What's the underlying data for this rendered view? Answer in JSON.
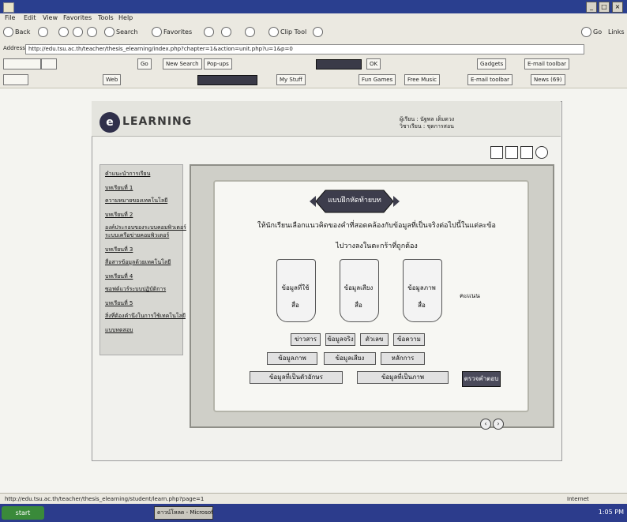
{
  "window": {
    "title": "",
    "min_glyph": "_",
    "max_glyph": "□",
    "close_glyph": "×"
  },
  "menu": [
    "File",
    "Edit",
    "View",
    "Favorites",
    "Tools",
    "Help"
  ],
  "toolbar": {
    "back": "Back",
    "search": "Search",
    "favorites": "Favorites",
    "clip_tool": "Clip Tool",
    "go": "Go",
    "links": "Links"
  },
  "address": {
    "label": "Address",
    "url": "http://edu.tsu.ac.th/teacher/thesis_elearning/index.php?chapter=1&action=unit.php?u=1&p=0"
  },
  "toolbar2": {
    "search_web": "Go",
    "news": "New Search",
    "popups": "Pop-ups",
    "ok": "OK",
    "gadgets": "Gadgets",
    "email": "E-mail toolbar"
  },
  "toolbar3": {
    "web": "Web",
    "my_stuff": "My Stuff",
    "fun_games": "Fun Games",
    "free_music": "Free Music",
    "email": "E-mail toolbar",
    "news": "News (69)"
  },
  "page": {
    "logo_mark": "e",
    "logo_text": "LEARNING",
    "user_line1": "ผู้เรียน : นัฐพล เต็มดวง",
    "user_line2": "วิชาเรียน : ชุดการสอน",
    "nav": [
      "คำแนะนำการเรียน",
      "บทเรียนที่ 1",
      "ความหมายของเทคโนโลยี",
      "บทเรียนที่ 2",
      "องค์ประกอบของระบบคอมพิวเตอร์",
      "ระบบเครือข่ายคอมพิวเตอร์",
      "บทเรียนที่ 3",
      "สื่อสารข้อมูลด้วยเทคโนโลยี",
      "บทเรียนที่ 4",
      "ซอฟต์แวร์ระบบปฏิบัติการ",
      "บทเรียนที่ 5",
      "สิ่งที่ต้องคำนึงในการใช้เทคโนโลยี",
      "แบบทดสอบ"
    ],
    "activity_title": "แบบฝึกหัดท้ายบท",
    "question": "ให้นักเรียนเลือกแนวคิดของคำที่สอดคล้องกับข้อมูลที่เป็นจริงต่อไปนี้ในแต่ละข้อ",
    "subquestion": "ไปวางลงในตะกร้าที่ถูกต้อง",
    "cups": [
      {
        "line1": "ข้อมูลที่ใช้",
        "line2": "สื่อ"
      },
      {
        "line1": "ข้อมูลเสียง",
        "line2": "สื่อ"
      },
      {
        "line1": "ข้อมูลภาพ",
        "line2": "สื่อ"
      }
    ],
    "answer_label": "คะแนน",
    "options_row1": [
      "ข่าวสาร",
      "ข้อมูลจริง",
      "ตัวเลข",
      "ข้อความ"
    ],
    "options_row2": [
      "ข้อมูลภาพ",
      "ข้อมูลเสียง",
      "หลักการ"
    ],
    "options_row3": [
      "ข้อมูลที่เป็นตัวอักษร",
      "ข้อมูลที่เป็นภาพ"
    ],
    "submit": "ตรวจคำตอบ",
    "prev": "‹",
    "next": "›"
  },
  "status": {
    "url": "http://edu.tsu.ac.th/teacher/thesis_elearning/student/learn.php?page=1",
    "zone": "Internet"
  },
  "taskbar": {
    "start": "start",
    "task": "ดาวน์โหลด - Microsoft Internet Explorer",
    "clock": "1:05 PM"
  }
}
